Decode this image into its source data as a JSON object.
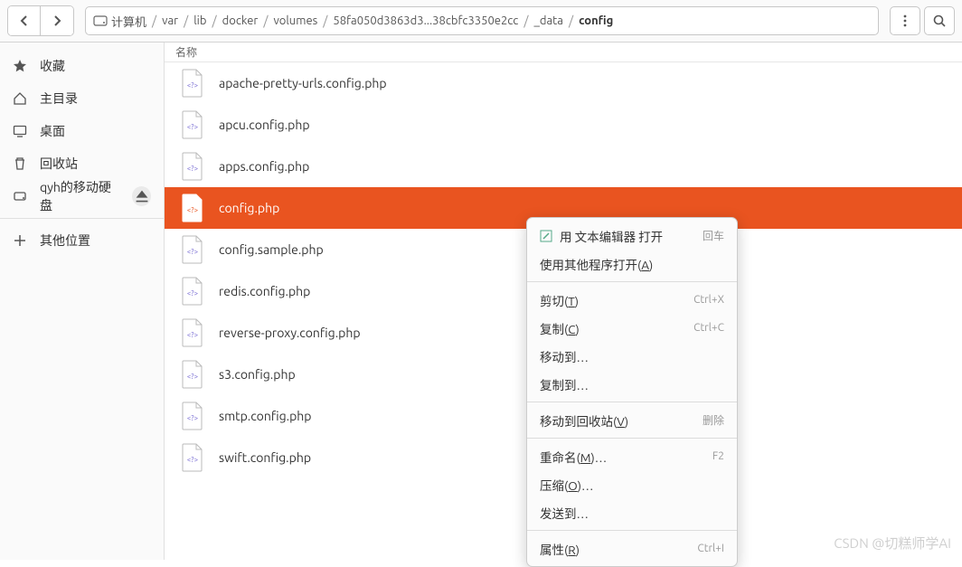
{
  "breadcrumb": {
    "computer": "计算机",
    "segs": [
      "var",
      "lib",
      "docker",
      "volumes",
      "58fa050d3863d3...38cbfc3350e2cc",
      "_data",
      "config"
    ]
  },
  "sidebar": {
    "favorites": "收藏",
    "home": "主目录",
    "desktop": "桌面",
    "trash": "回收站",
    "removable": "qyh的移动硬盘",
    "other": "其他位置"
  },
  "columns": {
    "name": "名称"
  },
  "files": [
    {
      "name": "apache-pretty-urls.config.php"
    },
    {
      "name": "apcu.config.php"
    },
    {
      "name": "apps.config.php"
    },
    {
      "name": "config.php",
      "selected": true
    },
    {
      "name": "config.sample.php"
    },
    {
      "name": "redis.config.php"
    },
    {
      "name": "reverse-proxy.config.php"
    },
    {
      "name": "s3.config.php"
    },
    {
      "name": "smtp.config.php"
    },
    {
      "name": "swift.config.php"
    }
  ],
  "menu": {
    "open_with_editor": "用 文本编辑器 打开",
    "open_with_editor_key": "回车",
    "open_with_other": "使用其他程序打开(A)",
    "cut": "剪切(T)",
    "cut_key": "Ctrl+X",
    "copy": "复制(C)",
    "copy_key": "Ctrl+C",
    "move_to": "移动到…",
    "copy_to": "复制到…",
    "move_to_trash": "移动到回收站(V)",
    "move_to_trash_key": "删除",
    "rename": "重命名(M)…",
    "rename_key": "F2",
    "compress": "压缩(O)…",
    "send_to": "发送到…",
    "properties": "属性(R)",
    "properties_key": "Ctrl+I"
  },
  "watermark": "CSDN @切糕师学AI"
}
